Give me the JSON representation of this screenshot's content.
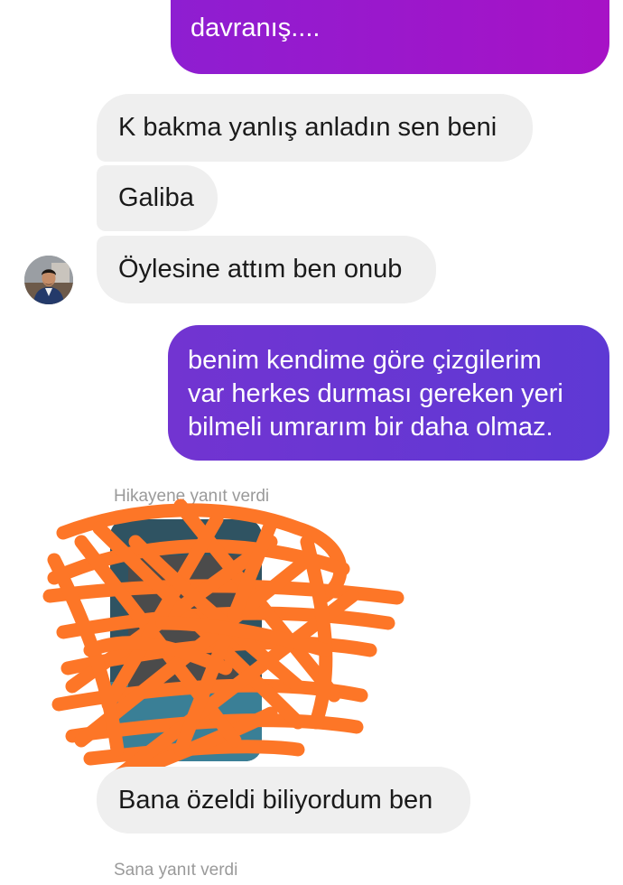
{
  "messages": {
    "top_partial": "davranış....",
    "incoming_1": "K bakma yanlış anladın sen beni",
    "incoming_2": "Galiba",
    "incoming_3": "Öylesine attım ben onub",
    "outgoing_lines": [
      "benim kendime göre çizgilerim",
      "var herkes durması gereken yeri",
      "bilmeli umrarım bir daha olmaz."
    ],
    "incoming_4": "Bana özeldi biliyordum ben"
  },
  "meta": {
    "story_reply": "Hikayene yanıt verdi",
    "replied_to_you": "Sana yanıt verdi"
  },
  "colors": {
    "incoming_bubble": "#efefef",
    "outgoing_top": "#a712c6",
    "outgoing_main": "#6436d2",
    "redaction": "#fd7627",
    "meta_text": "#9a9a9a"
  },
  "icons": {
    "avatar": "contact-avatar",
    "redaction": "redaction-scribble"
  }
}
